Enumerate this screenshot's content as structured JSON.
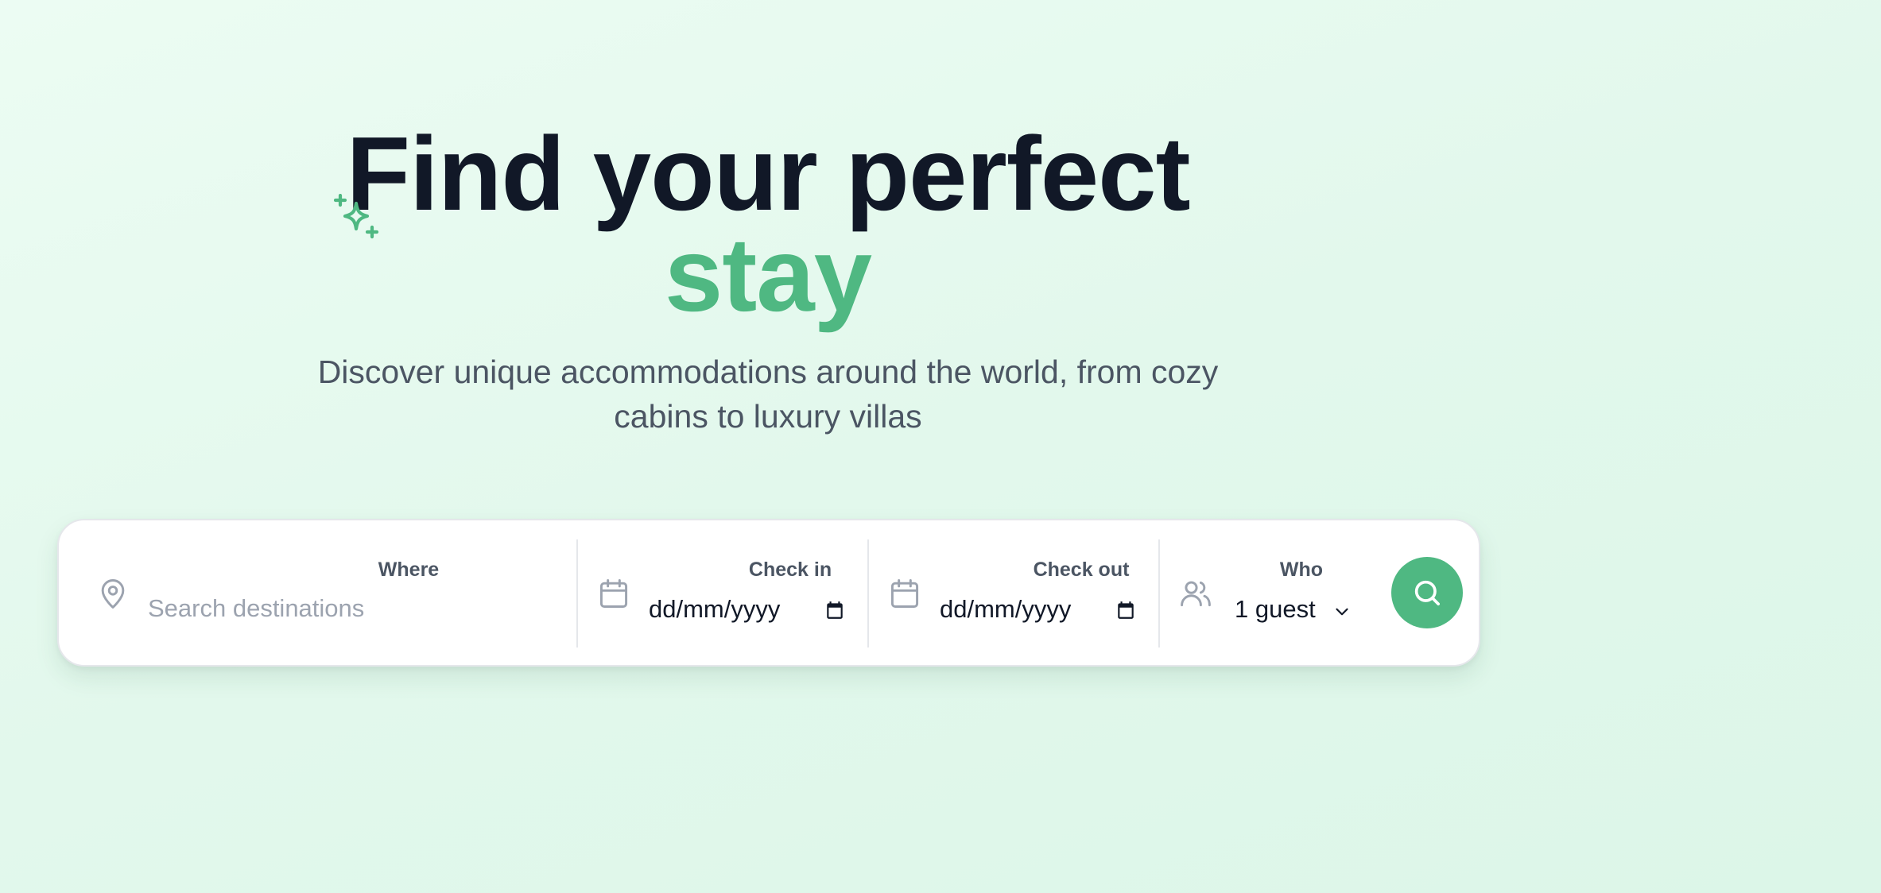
{
  "hero": {
    "title_line1": "Find your perfect",
    "title_line2": "stay",
    "subtitle_line1": "Discover unique accommodations around the world, from cozy",
    "subtitle_line2": "cabins to luxury villas"
  },
  "search": {
    "where_label": "Where",
    "where_placeholder": "Search destinations",
    "checkin_label": "Check in",
    "checkin_value": "dd/mm/yyyy",
    "checkout_label": "Check out",
    "checkout_value": "dd/mm/yyyy",
    "who_label": "Who",
    "who_value": "1 guest"
  },
  "colors": {
    "accent": "#4fb882",
    "heading": "#111827",
    "subtitle": "#4b5563",
    "background": "#e2f8ec"
  },
  "icons": {
    "sparkle": "sparkles-icon",
    "location": "map-pin-icon",
    "calendar": "calendar-icon",
    "guests": "users-icon",
    "dropdown": "chevron-down-icon",
    "search": "search-icon"
  }
}
